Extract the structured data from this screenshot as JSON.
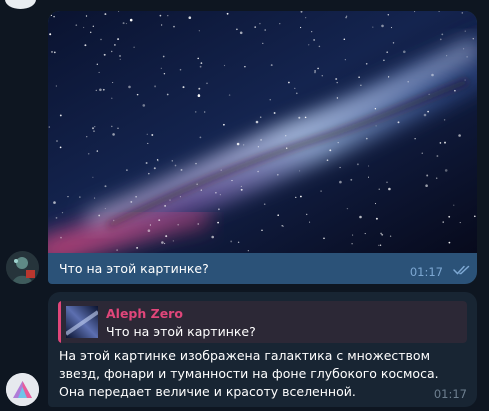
{
  "messages": {
    "outgoing": {
      "text": "Что на этой картинке?",
      "time": "01:17",
      "status": "read"
    },
    "reply": {
      "quote": {
        "author": "Aleph Zero",
        "text": "Что на этой картинке?"
      },
      "text": "На этой картинке изображена галактика с множеством звезд, фонари и туманности на фоне глубокого космоса. Она передает величие и красоту вселенной.",
      "time": "01:17"
    }
  },
  "colors": {
    "background": "#0e1621",
    "outgoing_bubble": "#2b5278",
    "incoming_bubble": "#182533",
    "quote_accent": "#e0467a",
    "read_checks": "#7da8d3"
  },
  "icons": {
    "read_status": "double-check-icon",
    "user_avatar": "user-avatar",
    "bot_avatar": "bot-avatar-logo"
  }
}
